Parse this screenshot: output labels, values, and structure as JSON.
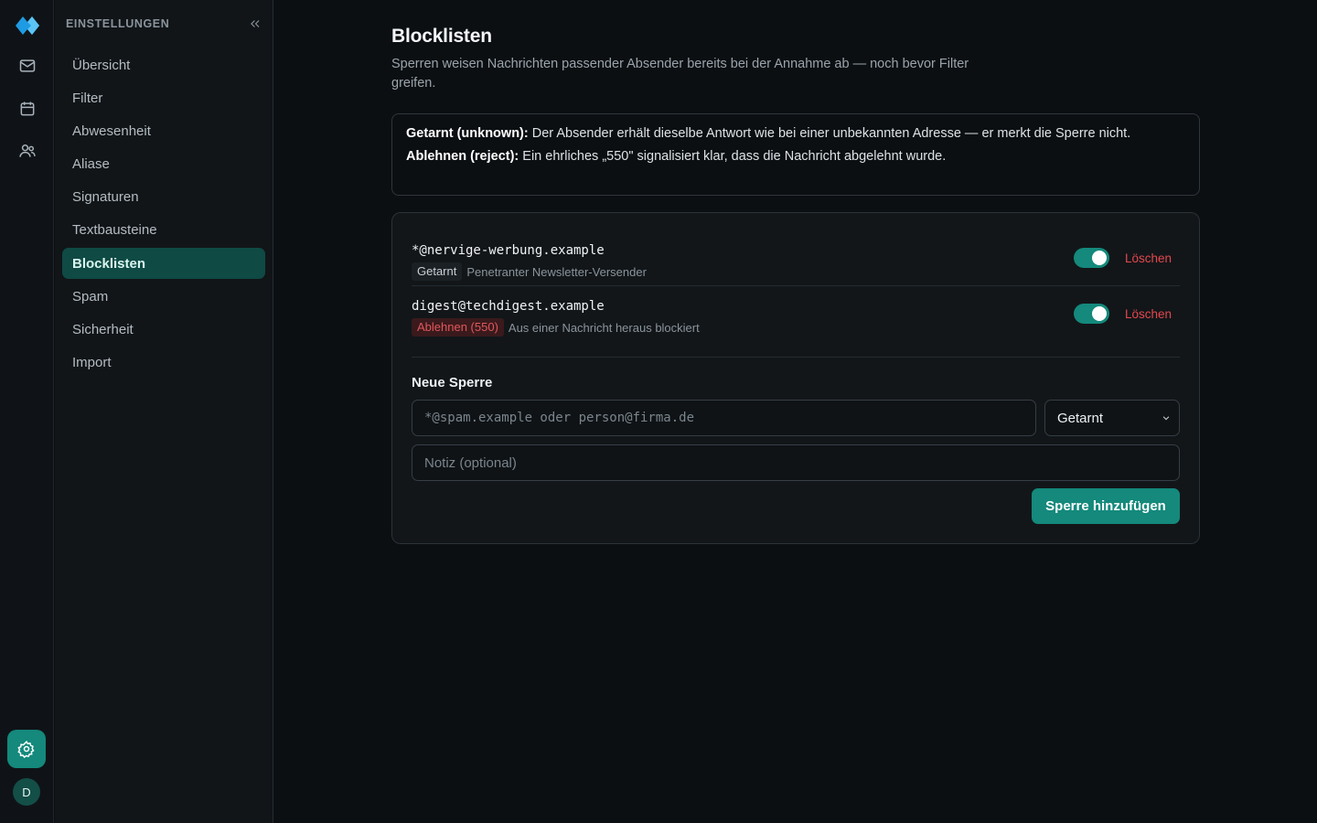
{
  "rail": {
    "icons": [
      "logo-icon",
      "mail-icon",
      "calendar-icon",
      "contacts-icon",
      "gear-icon"
    ],
    "avatar_initial": "D"
  },
  "sidebar": {
    "title": "EINSTELLUNGEN",
    "items": [
      {
        "label": "Übersicht"
      },
      {
        "label": "Filter"
      },
      {
        "label": "Abwesenheit"
      },
      {
        "label": "Aliase"
      },
      {
        "label": "Signaturen"
      },
      {
        "label": "Textbausteine"
      },
      {
        "label": "Blocklisten",
        "active": true
      },
      {
        "label": "Spam"
      },
      {
        "label": "Sicherheit"
      },
      {
        "label": "Import"
      }
    ]
  },
  "page": {
    "title": "Blocklisten",
    "description": "Sperren weisen Nachrichten passender Absender bereits bei der Annahme ab — noch bevor Filter greifen."
  },
  "info": {
    "stealth_label": "Getarnt (unknown):",
    "stealth_text": " Der Absender erhält dieselbe Antwort wie bei einer unbekannten Adresse — er merkt die Sperre nicht.",
    "reject_label": "Ablehnen (reject):",
    "reject_text": " Ein ehrliches „550\" signalisiert klar, dass die Nachricht abgelehnt wurde."
  },
  "entries": [
    {
      "address": "*@nervige-werbung.example",
      "mode": "Getarnt",
      "note": "Penetranter Newsletter-Versender",
      "enabled": true,
      "delete_label": "Löschen"
    },
    {
      "address": "digest@techdigest.example",
      "mode": "Ablehnen (550)",
      "note": "Aus einer Nachricht heraus blockiert",
      "enabled": true,
      "delete_label": "Löschen"
    }
  ],
  "new_block": {
    "title": "Neue Sperre",
    "address_placeholder": "*@spam.example oder person@firma.de",
    "mode_value": "Getarnt",
    "note_placeholder": "Notiz (optional)",
    "submit_label": "Sperre hinzufügen"
  },
  "colors": {
    "accent": "#14897c",
    "danger": "#e3484e",
    "background": "#0c0f12"
  }
}
